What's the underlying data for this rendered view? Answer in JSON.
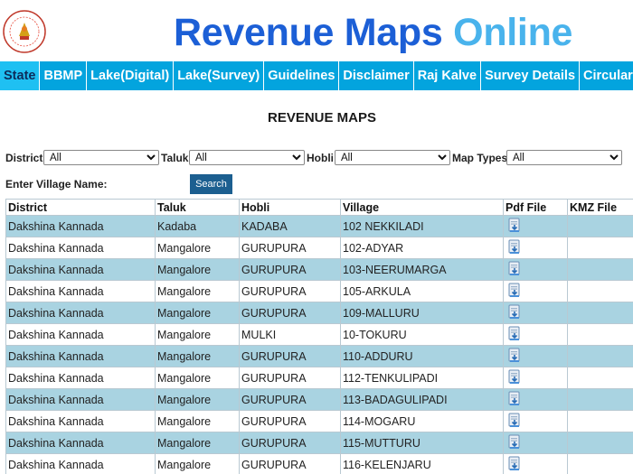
{
  "header": {
    "brand_part1": "Revenue Maps",
    "brand_part2": "Online",
    "colors": {
      "brand_primary": "#1c5fd6",
      "brand_secondary": "#49b3ec",
      "nav_bg": "#03a4de"
    }
  },
  "nav": {
    "items": [
      {
        "label": "State"
      },
      {
        "label": "BBMP"
      },
      {
        "label": "Lake(Digital)"
      },
      {
        "label": "Lake(Survey)"
      },
      {
        "label": "Guidelines"
      },
      {
        "label": "Disclaimer"
      },
      {
        "label": "Raj Kalve"
      },
      {
        "label": "Survey Details"
      },
      {
        "label": "Circular"
      }
    ],
    "active_index": 0
  },
  "page": {
    "title": "REVENUE MAPS"
  },
  "filters": {
    "district": {
      "label": "District",
      "value": "All"
    },
    "taluk": {
      "label": "Taluk",
      "value": "All"
    },
    "hobli": {
      "label": "Hobli",
      "value": "All"
    },
    "map_types": {
      "label": "Map Types",
      "value": "All"
    }
  },
  "village_search": {
    "label": "Enter Village Name:",
    "value": "",
    "button_label": "Search"
  },
  "table": {
    "headers": [
      "District",
      "Taluk",
      "Hobli",
      "Village",
      "Pdf File",
      "KMZ File"
    ],
    "rows": [
      {
        "district": "Dakshina Kannada",
        "taluk": "Kadaba",
        "hobli": "KADABA",
        "village": "102 NEKKILADI",
        "pdf_icon": "pdf-download-icon",
        "kmz": ""
      },
      {
        "district": "Dakshina Kannada",
        "taluk": "Mangalore",
        "hobli": "GURUPURA",
        "village": "102-ADYAR",
        "pdf_icon": "pdf-download-icon",
        "kmz": ""
      },
      {
        "district": "Dakshina Kannada",
        "taluk": "Mangalore",
        "hobli": "GURUPURA",
        "village": "103-NEERUMARGA",
        "pdf_icon": "pdf-download-icon",
        "kmz": ""
      },
      {
        "district": "Dakshina Kannada",
        "taluk": "Mangalore",
        "hobli": "GURUPURA",
        "village": "105-ARKULA",
        "pdf_icon": "pdf-download-icon",
        "kmz": ""
      },
      {
        "district": "Dakshina Kannada",
        "taluk": "Mangalore",
        "hobli": "GURUPURA",
        "village": "109-MALLURU",
        "pdf_icon": "pdf-download-icon",
        "kmz": ""
      },
      {
        "district": "Dakshina Kannada",
        "taluk": "Mangalore",
        "hobli": "MULKI",
        "village": "10-TOKURU",
        "pdf_icon": "pdf-download-icon",
        "kmz": ""
      },
      {
        "district": "Dakshina Kannada",
        "taluk": "Mangalore",
        "hobli": "GURUPURA",
        "village": "110-ADDURU",
        "pdf_icon": "pdf-download-icon",
        "kmz": ""
      },
      {
        "district": "Dakshina Kannada",
        "taluk": "Mangalore",
        "hobli": "GURUPURA",
        "village": "112-TENKULIPADI",
        "pdf_icon": "pdf-download-icon",
        "kmz": ""
      },
      {
        "district": "Dakshina Kannada",
        "taluk": "Mangalore",
        "hobli": "GURUPURA",
        "village": "113-BADAGULIPADI",
        "pdf_icon": "pdf-download-icon",
        "kmz": ""
      },
      {
        "district": "Dakshina Kannada",
        "taluk": "Mangalore",
        "hobli": "GURUPURA",
        "village": "114-MOGARU",
        "pdf_icon": "pdf-download-icon",
        "kmz": ""
      },
      {
        "district": "Dakshina Kannada",
        "taluk": "Mangalore",
        "hobli": "GURUPURA",
        "village": "115-MUTTURU",
        "pdf_icon": "pdf-download-icon",
        "kmz": ""
      },
      {
        "district": "Dakshina Kannada",
        "taluk": "Mangalore",
        "hobli": "GURUPURA",
        "village": "116-KELENJARU",
        "pdf_icon": "pdf-download-icon",
        "kmz": ""
      }
    ]
  }
}
